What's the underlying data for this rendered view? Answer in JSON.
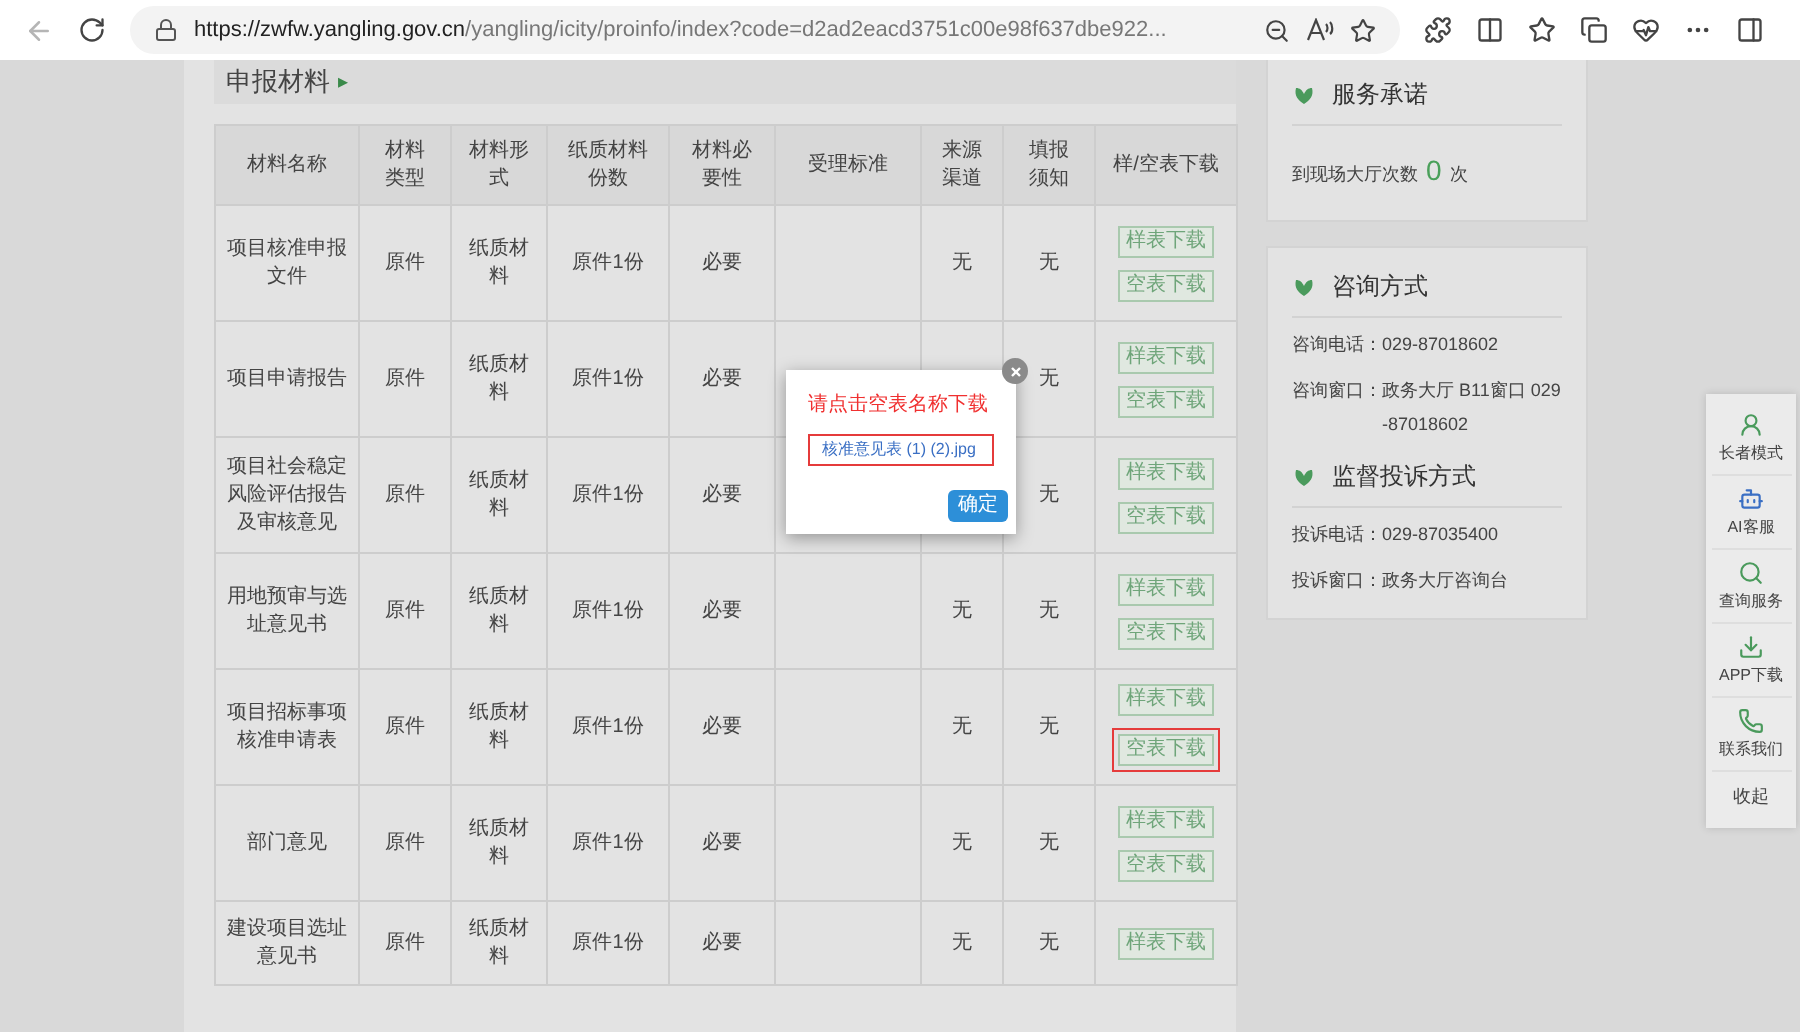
{
  "browser": {
    "url_host": "https://zwfw.yangling.gov.cn",
    "url_path": "/yangling/icity/proinfo/index?code=d2ad2eacd3751c00e98f637dbe922..."
  },
  "section": {
    "title": "申报材料",
    "marker": "▸"
  },
  "table": {
    "columns": [
      "材料名称",
      "材料类型",
      "材料形式",
      "纸质材料份数",
      "材料必要性",
      "受理标准",
      "来源渠道",
      "填报须知",
      "样/空表下载"
    ],
    "rows": [
      {
        "name": "项目核准申报文件",
        "type": "原件",
        "form": "纸质材料",
        "copies": "原件1份",
        "necessity": "必要",
        "source": "无",
        "notice": "无",
        "downloads": [
          {
            "label": "样表下载",
            "highlighted": false
          },
          {
            "label": "空表下载",
            "highlighted": false
          }
        ]
      },
      {
        "name": "项目申请报告",
        "type": "原件",
        "form": "纸质材料",
        "copies": "原件1份",
        "necessity": "必要",
        "notice": "无",
        "downloads": [
          {
            "label": "样表下载",
            "highlighted": false
          },
          {
            "label": "空表下载",
            "highlighted": false
          }
        ]
      },
      {
        "name": "项目社会稳定风险评估报告及审核意见",
        "type": "原件",
        "form": "纸质材料",
        "copies": "原件1份",
        "necessity": "必要",
        "notice": "无",
        "downloads": [
          {
            "label": "样表下载",
            "highlighted": false
          },
          {
            "label": "空表下载",
            "highlighted": false
          }
        ]
      },
      {
        "name": "用地预审与选址意见书",
        "type": "原件",
        "form": "纸质材料",
        "copies": "原件1份",
        "necessity": "必要",
        "source": "无",
        "notice": "无",
        "downloads": [
          {
            "label": "样表下载",
            "highlighted": false
          },
          {
            "label": "空表下载",
            "highlighted": false
          }
        ]
      },
      {
        "name": "项目招标事项核准申请表",
        "type": "原件",
        "form": "纸质材料",
        "copies": "原件1份",
        "necessity": "必要",
        "source": "无",
        "notice": "无",
        "downloads": [
          {
            "label": "样表下载",
            "highlighted": false
          },
          {
            "label": "空表下载",
            "highlighted": true
          }
        ]
      },
      {
        "name": "部门意见",
        "type": "原件",
        "form": "纸质材料",
        "copies": "原件1份",
        "necessity": "必要",
        "source": "无",
        "notice": "无",
        "downloads": [
          {
            "label": "样表下载",
            "highlighted": false
          },
          {
            "label": "空表下载",
            "highlighted": false
          }
        ]
      },
      {
        "name": "建设项目选址意见书",
        "type": "原件",
        "form": "纸质材料",
        "copies": "原件1份",
        "necessity": "必要",
        "source": "无",
        "notice": "无",
        "downloads": [
          {
            "label": "样表下载",
            "highlighted": false
          }
        ]
      }
    ]
  },
  "modal": {
    "title": "请点击空表名称下载",
    "file": "核准意见表 (1) (2).jpg",
    "file_highlighted": true,
    "confirm": "确定"
  },
  "service": {
    "title": "服务承诺",
    "visits_label": "到现场大厅次数",
    "visits": "0",
    "visits_unit": "次"
  },
  "consult": {
    "title": "咨询方式",
    "lines": [
      {
        "label": "咨询电话：",
        "value": "029-87018602"
      },
      {
        "label": "咨询窗口：",
        "value": "政务大厅 B11窗口 029-87018602"
      }
    ]
  },
  "complaint": {
    "title": "监督投诉方式",
    "lines": [
      {
        "label": "投诉电话：",
        "value": "029-87035400"
      },
      {
        "label": "投诉窗口：",
        "value": "政务大厅咨询台"
      }
    ]
  },
  "float_bar": {
    "items": [
      {
        "kind": "elder",
        "label": "长者模式"
      },
      {
        "kind": "ai",
        "label": "AI客服"
      },
      {
        "kind": "search",
        "label": "查询服务"
      },
      {
        "kind": "download",
        "label": "APP下载"
      },
      {
        "kind": "phone",
        "label": "联系我们"
      },
      {
        "kind": "collapse",
        "label": "收起"
      }
    ]
  }
}
